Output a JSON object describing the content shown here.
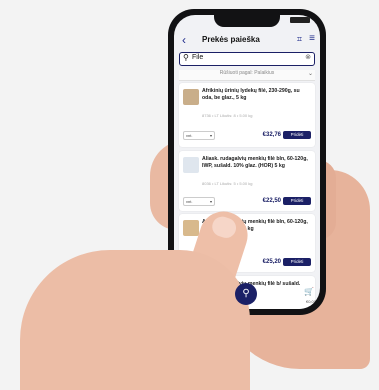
{
  "header": {
    "title": "Prekės paieška"
  },
  "search": {
    "value": "File"
  },
  "sort": {
    "label": "Rūšiuoti pagal: Palaikius"
  },
  "products": [
    {
      "name": "Afrikinių ūrinių lydekų filė, 230-290g, su oda, be glaz., 5 kg",
      "meta": "8736 • LT Likutis: 8 • 5.00 kg",
      "unit": "vnt.",
      "price": "€32,76",
      "button": "Pridėti"
    },
    {
      "name": "Aliask. rudagalvių menkių filė bln, 60-120g, IWP, sušald. 10% glaz. (HOR) 5 kg",
      "meta": "8036 • LT Likutis: 5 • 5.00 kg",
      "unit": "vnt.",
      "price": "€22,50",
      "button": "Pridėti"
    },
    {
      "name": "Aliask. rudagalvių menkių filė bln, 60-120g, sušald. 0% glaz. 6 kg",
      "meta": "",
      "unit": "vnt.",
      "price": "€25,20",
      "button": "Pridėti"
    },
    {
      "name": "Aliask. rudagalvių menkių filė b/ sušald. glaz. 800g",
      "meta": "",
      "unit": "",
      "price": "",
      "button": ""
    }
  ],
  "cart": {
    "total": "€0,00"
  },
  "colors": {
    "accent": "#1b2066"
  }
}
